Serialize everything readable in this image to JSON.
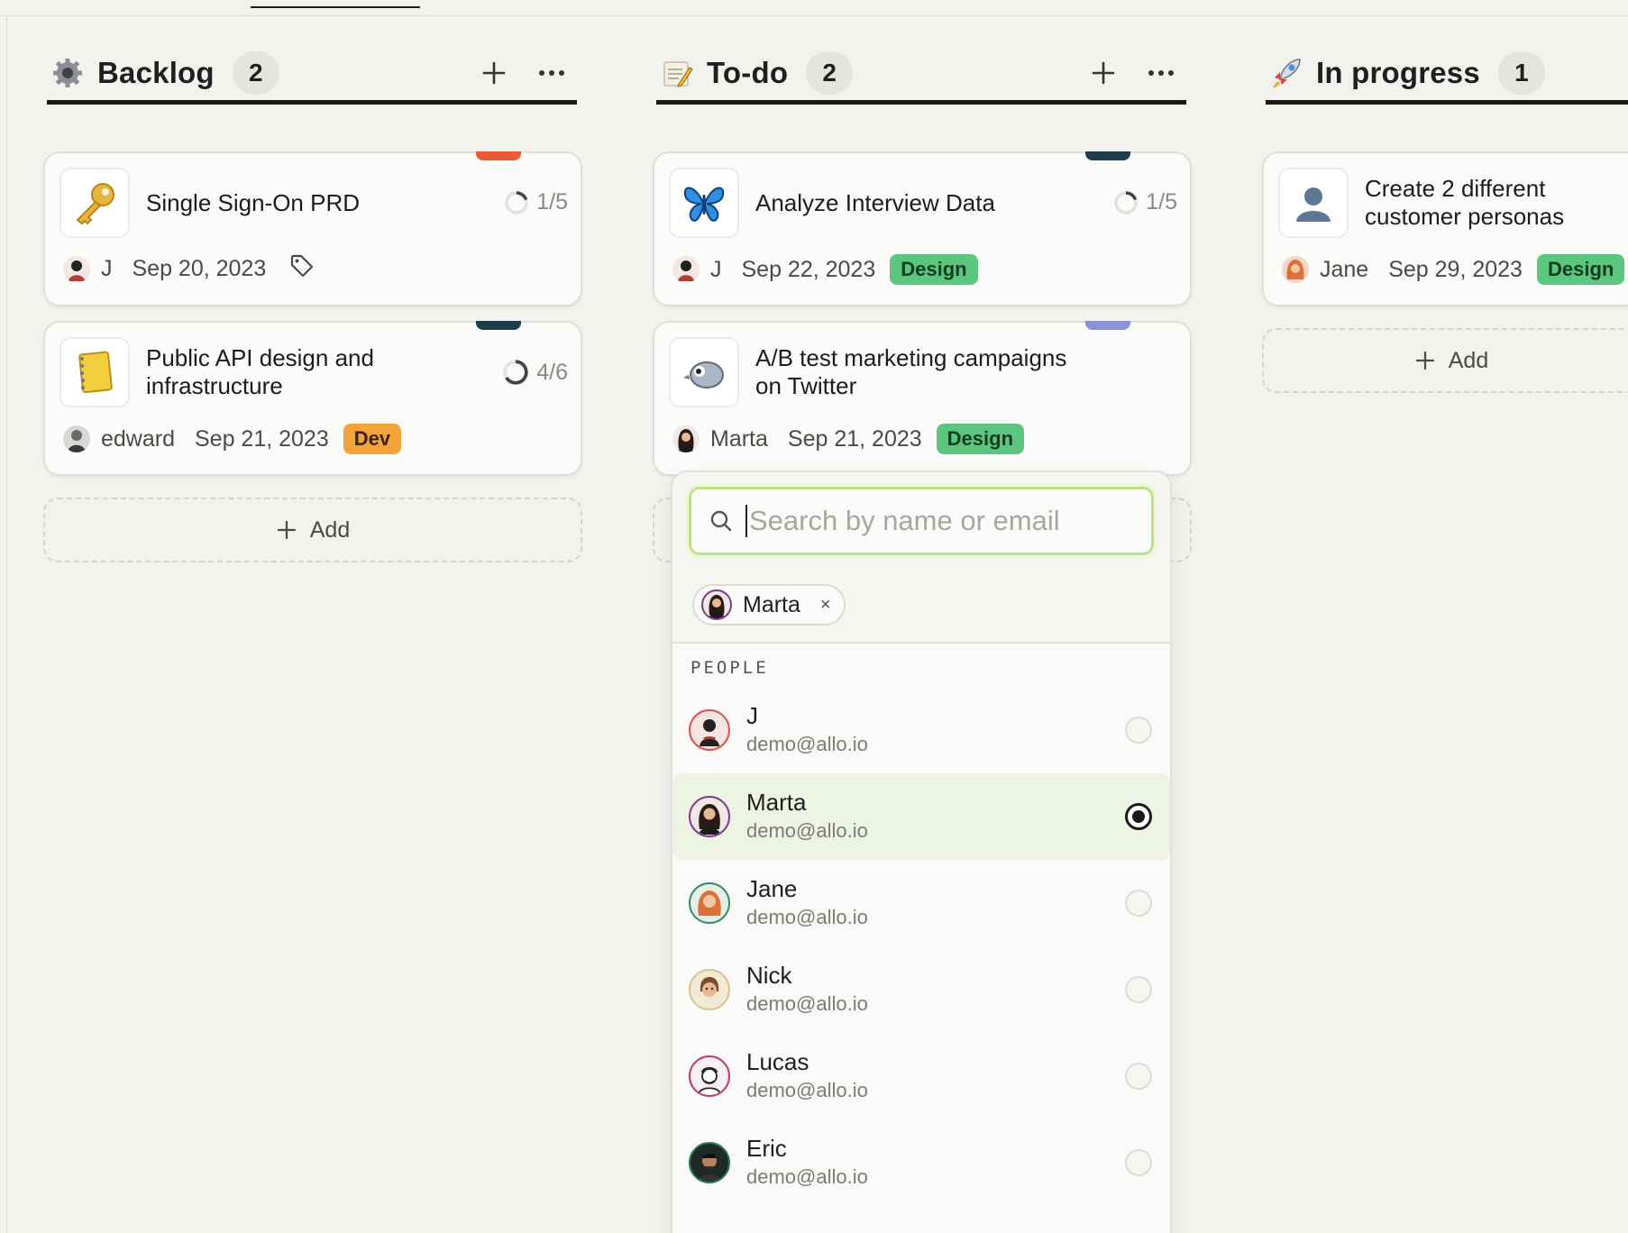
{
  "columns": [
    {
      "title": "Backlog",
      "count": "2",
      "icon": "gear-icon",
      "cards": [
        {
          "title": "Single Sign-On PRD",
          "progress": "1/5",
          "assignee": "J",
          "date": "Sep 20, 2023",
          "badge": "",
          "accent": "#ea5a35",
          "thumb_icon": "key-icon"
        },
        {
          "title": "Public API design and infrastructure",
          "progress": "4/6",
          "assignee": "edward",
          "date": "Sep 21, 2023",
          "badge": "Dev",
          "accent": "#1e3d4a",
          "thumb_icon": "notebook-icon"
        }
      ],
      "add_label": "Add"
    },
    {
      "title": "To-do",
      "count": "2",
      "icon": "memo-icon",
      "cards": [
        {
          "title": "Analyze Interview Data",
          "progress": "1/5",
          "assignee": "J",
          "date": "Sep 22, 2023",
          "badge": "Design",
          "accent": "#1e3d4a",
          "thumb_icon": "butterfly-icon"
        },
        {
          "title": "A/B test marketing campaigns on Twitter",
          "progress": "",
          "assignee": "Marta",
          "date": "Sep 21, 2023",
          "badge": "Design",
          "accent": "#8a93d8",
          "thumb_icon": "bird-icon"
        }
      ]
    },
    {
      "title": "In progress",
      "count": "1",
      "icon": "rocket-icon",
      "cards": [
        {
          "title": "Create 2 different customer personas",
          "assignee": "Jane",
          "date": "Sep 29, 2023",
          "badge": "Design",
          "thumb_icon": "user-silhouette-icon"
        }
      ],
      "add_label": "Add"
    }
  ],
  "dropdown": {
    "search_placeholder": "Search by name or email",
    "search_value": "",
    "selected_chip": "Marta",
    "chip_remove": "×",
    "section_label": "PEOPLE",
    "people": [
      {
        "name": "J",
        "email": "demo@allo.io",
        "selected": false
      },
      {
        "name": "Marta",
        "email": "demo@allo.io",
        "selected": true
      },
      {
        "name": "Jane",
        "email": "demo@allo.io",
        "selected": false
      },
      {
        "name": "Nick",
        "email": "demo@allo.io",
        "selected": false
      },
      {
        "name": "Lucas",
        "email": "demo@allo.io",
        "selected": false
      },
      {
        "name": "Eric",
        "email": "demo@allo.io",
        "selected": false
      }
    ]
  },
  "colors": {
    "design_badge": "#5dc67e",
    "dev_badge": "#f2a43a",
    "search_focus": "#bfe08a",
    "selected_row": "#eef4e4"
  }
}
